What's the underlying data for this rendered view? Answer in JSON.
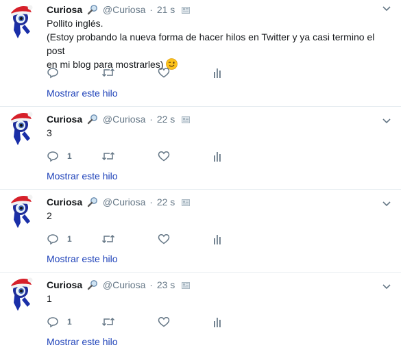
{
  "tweets": [
    {
      "name": "Curiosa",
      "handle": "@Curiosa",
      "dot": "·",
      "time": "21 s",
      "lines": [
        "Pollito inglés.",
        "(Estoy probando la nueva forma de hacer hilos en Twitter y ya casi termino el post",
        "en mi blog para mostrarles) "
      ],
      "emoji": "winking-face",
      "reply_count": "",
      "thread_link": "Mostrar este hilo"
    },
    {
      "name": "Curiosa",
      "handle": "@Curiosa",
      "dot": "·",
      "time": "22 s",
      "lines": [
        "3"
      ],
      "reply_count": "1",
      "thread_link": "Mostrar este hilo"
    },
    {
      "name": "Curiosa",
      "handle": "@Curiosa",
      "dot": "·",
      "time": "22 s",
      "lines": [
        "2"
      ],
      "reply_count": "1",
      "thread_link": "Mostrar este hilo"
    },
    {
      "name": "Curiosa",
      "handle": "@Curiosa",
      "dot": "·",
      "time": "23 s",
      "lines": [
        "1"
      ],
      "reply_count": "1",
      "thread_link": "Mostrar este hilo"
    }
  ],
  "colors": {
    "link": "#1b3fb8",
    "muted": "#657786",
    "text": "#14171a",
    "divider": "#e6ecf0"
  },
  "icons": [
    "avatar-santa-hat-eye",
    "magnifier-icon",
    "card-icon",
    "chevron-down-icon",
    "reply-icon",
    "retweet-icon",
    "like-icon",
    "analytics-icon",
    "winking-face-emoji"
  ]
}
